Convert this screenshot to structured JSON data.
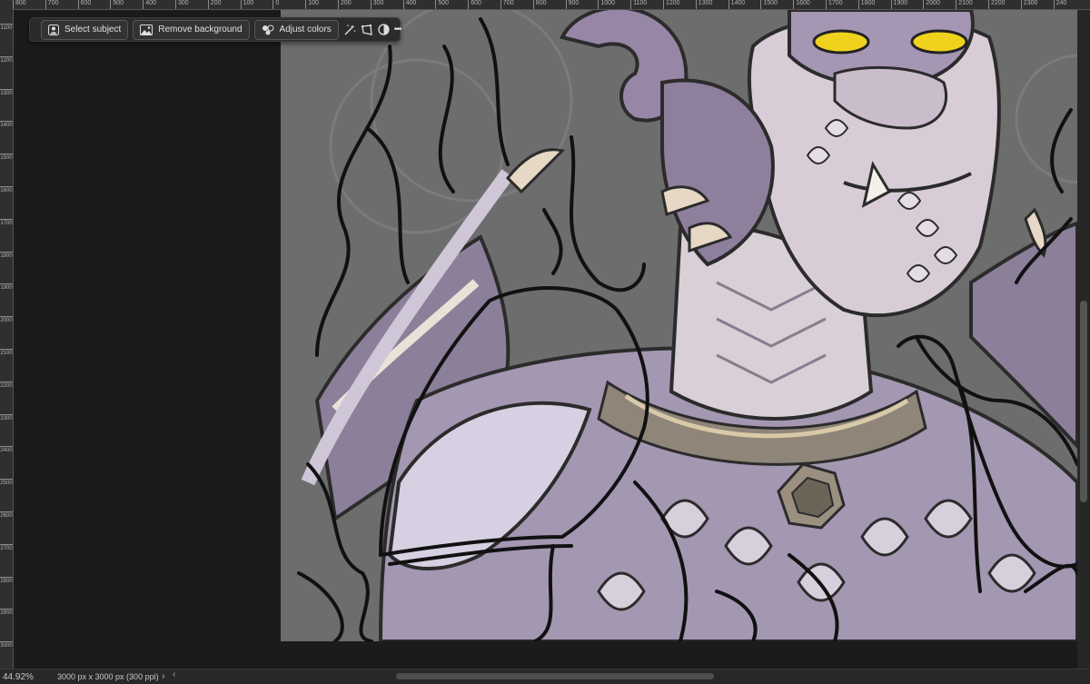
{
  "toolbar": {
    "select_subject_label": "Select subject",
    "remove_background_label": "Remove background",
    "adjust_colors_label": "Adjust colors",
    "more_label": "•••"
  },
  "ruler_top": {
    "ticks": [
      "800",
      "700",
      "600",
      "500",
      "400",
      "300",
      "200",
      "100",
      "0",
      "100",
      "200",
      "300",
      "400",
      "500",
      "600",
      "700",
      "800",
      "900",
      "1000",
      "1100",
      "1200",
      "1300",
      "1400",
      "1500",
      "1600",
      "1700",
      "1800",
      "1900",
      "2000",
      "2100",
      "2200",
      "2300",
      "240"
    ]
  },
  "ruler_left": {
    "ticks": [
      "1100",
      "1200",
      "1300",
      "1400",
      "1500",
      "1600",
      "1700",
      "1800",
      "1900",
      "2000",
      "2100",
      "2200",
      "2300",
      "2400",
      "2500",
      "2600",
      "2700",
      "2800",
      "2900",
      "3000"
    ]
  },
  "status": {
    "zoom": "44.92%",
    "document_size": "3000 px x 3000 px (300 ppi)"
  },
  "colors": {
    "canvas_bg": "#6d6d6d",
    "eyes": "#f0d21e",
    "ink": "#111111"
  }
}
